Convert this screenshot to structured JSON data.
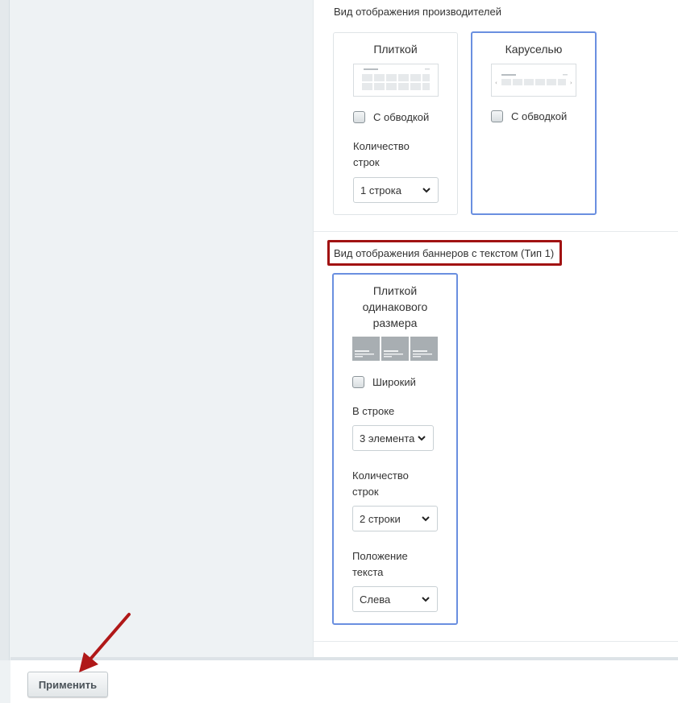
{
  "manufacturers": {
    "section_title": "Вид отображения производителей",
    "cards": [
      {
        "title": "Плиткой",
        "selected": false,
        "checkbox_label": "С обводкой",
        "checked": false,
        "rows_label": "Количество строк",
        "rows_value": "1 строка"
      },
      {
        "title": "Каруселью",
        "selected": true,
        "checkbox_label": "С обводкой",
        "checked": false
      }
    ]
  },
  "banners": {
    "section_title": "Вид отображения баннеров с текстом (Тип 1)",
    "card": {
      "title": "Плиткой одинакового размера",
      "selected": true,
      "checkbox_label": "Широкий",
      "checked": false,
      "per_row_label": "В строке",
      "per_row_value": "3 элемента",
      "rows_label": "Количество строк",
      "rows_value": "2 строки",
      "text_position_label": "Положение текста",
      "text_position_value": "Слева"
    }
  },
  "footer": {
    "apply_label": "Применить"
  },
  "colors": {
    "selected_border": "#6a8fe0",
    "highlight_box": "#a11212",
    "annotation_arrow": "#b01818"
  },
  "icons": [
    "chevron-down-icon",
    "checkbox-icon",
    "tile-layout-preview",
    "carousel-layout-preview",
    "banner-tiles-preview",
    "annotation-arrow-icon"
  ]
}
